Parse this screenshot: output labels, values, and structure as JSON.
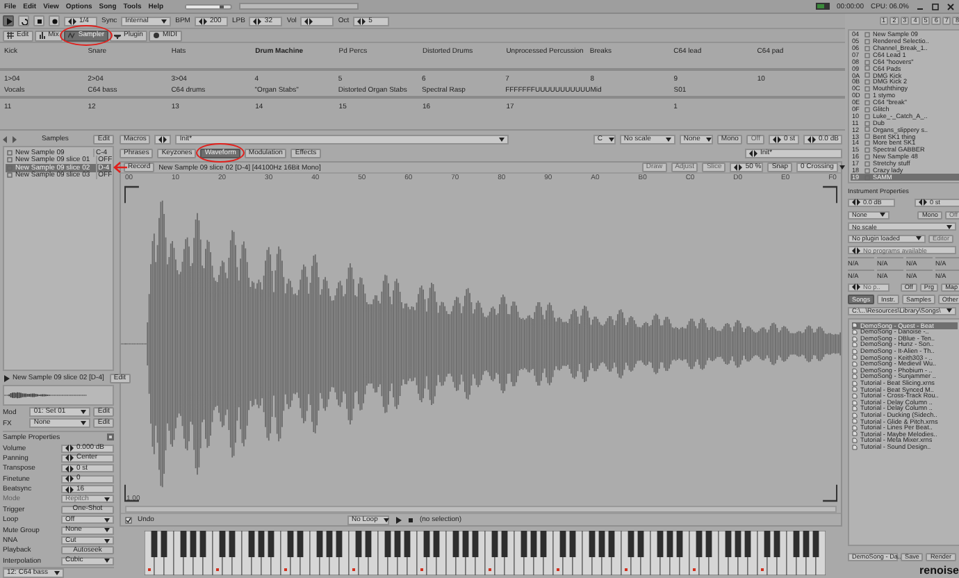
{
  "menu": [
    "File",
    "Edit",
    "View",
    "Options",
    "Song",
    "Tools",
    "Help"
  ],
  "master_volume": {
    "level": 0.85
  },
  "status": {
    "time": "00:00:00",
    "cpu": "CPU: 06.0%"
  },
  "toolbar": {
    "edit_step": "1/4",
    "sync_label": "Sync",
    "sync": "Internal",
    "bpm_label": "BPM",
    "bpm": "200",
    "lpb_label": "LPB",
    "lpb": "32",
    "vol_label": "Vol",
    "oct_label": "Oct",
    "oct": "5"
  },
  "tabs": [
    {
      "label": "Edit",
      "selected": false,
      "circled": false
    },
    {
      "label": "Mix",
      "selected": false,
      "circled": false
    },
    {
      "label": "Sampler",
      "selected": true,
      "circled": true
    },
    {
      "label": "Plugin",
      "selected": false,
      "circled": false
    },
    {
      "label": "MIDI",
      "selected": false,
      "circled": false
    }
  ],
  "pattern_columns": [
    [
      {
        "name": "Kick",
        "selected": false
      },
      {
        "number": "1>04",
        "name": "Vocals",
        "selected": false
      },
      {
        "number": "11",
        "selected": false
      }
    ],
    [
      {
        "name": "Snare",
        "selected": false
      },
      {
        "number": "2>04",
        "name": "C64 bass",
        "selected": false
      },
      {
        "number": "12",
        "selected": false
      }
    ],
    [
      {
        "name": "Hats",
        "selected": false
      },
      {
        "number": "3>04",
        "name": "C64 drums",
        "selected": false
      },
      {
        "number": "13",
        "selected": false
      }
    ],
    [
      {
        "name": "Drum Machine",
        "selected": true
      },
      {
        "number": "4",
        "name": "\"Organ Stabs\"",
        "selected": false
      },
      {
        "number": "14",
        "selected": false
      }
    ],
    [
      {
        "name": "Pd Percs",
        "selected": false
      },
      {
        "number": "5",
        "name": "Distorted Organ Stabs",
        "selected": false
      },
      {
        "number": "15",
        "selected": false
      }
    ],
    [
      {
        "name": "Distorted Drums",
        "selected": false
      },
      {
        "number": "6",
        "name": "Spectral Rasp",
        "selected": false
      },
      {
        "number": "16",
        "selected": false
      }
    ],
    [
      {
        "name": "Unprocessed Percussion",
        "selected": false
      },
      {
        "number": "7",
        "name": "FFFFFFFUUUUUUUUUUU",
        "selected": false
      },
      {
        "number": "17",
        "selected": false
      }
    ],
    [
      {
        "name": "Breaks",
        "selected": false
      },
      {
        "number": "8",
        "name": "Mid",
        "selected": false
      }
    ],
    [
      {
        "name": "C64 lead",
        "selected": false
      },
      {
        "number": "9",
        "name": "S01",
        "selected": false
      },
      {
        "number": "1",
        "selected": false
      }
    ],
    [
      {
        "name": "C64 pad",
        "selected": false
      },
      {
        "number": "10",
        "selected": false
      }
    ]
  ],
  "samples": {
    "title": "Samples",
    "edit": "Edit",
    "items": [
      {
        "name": "New Sample 09",
        "note": "C-4",
        "selected": false,
        "arrow": false
      },
      {
        "name": "New Sample 09 slice 01",
        "note": "OFF",
        "selected": false,
        "arrow": false
      },
      {
        "name": "New Sample 09 slice 02",
        "note": "D-4",
        "selected": true,
        "arrow": true
      },
      {
        "name": "New Sample 09 slice 03",
        "note": "OFF",
        "selected": false,
        "arrow": false
      }
    ]
  },
  "current_sample": {
    "name": "New Sample 09 slice 02 [D-4]",
    "edit": "Edit"
  },
  "mod": {
    "label": "Mod",
    "value": "01: Set 01",
    "edit": "Edit"
  },
  "fx": {
    "label": "FX",
    "value": "None",
    "edit": "Edit"
  },
  "sample_properties": {
    "title": "Sample Properties",
    "rows": [
      {
        "label": "Volume",
        "value": "0.000 dB",
        "kind": "spin",
        "disabled": false
      },
      {
        "label": "Panning",
        "value": "Center",
        "kind": "spin",
        "disabled": false
      },
      {
        "label": "Transpose",
        "value": "0 st",
        "kind": "spin",
        "disabled": false
      },
      {
        "label": "Finetune",
        "value": "0",
        "kind": "spin",
        "disabled": false
      },
      {
        "label": "Beatsync",
        "value": "16",
        "kind": "spin",
        "disabled": false
      },
      {
        "label": "Mode",
        "value": "Repitch",
        "kind": "dropdown",
        "disabled": true
      },
      {
        "label": "Trigger",
        "value": "One-Shot",
        "kind": "button",
        "disabled": false
      },
      {
        "label": "Loop",
        "value": "Off",
        "kind": "dropdown",
        "disabled": false
      },
      {
        "label": "Mute Group",
        "value": "None",
        "kind": "dropdown",
        "disabled": false
      },
      {
        "label": "NNA",
        "value": "Cut",
        "kind": "dropdown",
        "disabled": false
      },
      {
        "label": "Playback",
        "value": "Autoseek",
        "kind": "button",
        "disabled": false
      },
      {
        "label": "Interpolation",
        "value": "Cubic",
        "kind": "dropdown",
        "disabled": false
      }
    ]
  },
  "status_line": "12: C64 bass",
  "instrument_bar": {
    "macros": "Macros",
    "preset": "Init*",
    "key": "C",
    "scale": "No scale",
    "keyzone": "None",
    "mono": "Mono",
    "glide": "Off",
    "transpose": "0 st",
    "volume": "0.0 dB"
  },
  "editor_tabs": [
    {
      "label": "Phrases",
      "selected": false,
      "circled": false
    },
    {
      "label": "Keyzones",
      "selected": false,
      "circled": false
    },
    {
      "label": "Waveform",
      "selected": true,
      "circled": true
    },
    {
      "label": "Modulation",
      "selected": false,
      "circled": false
    },
    {
      "label": "Effects",
      "selected": false,
      "circled": false
    }
  ],
  "fx_preset": "Init*",
  "waveform_header": {
    "record": "Record",
    "title": "New Sample 09 slice 02 [D-4] [44100Hz 16Bit Mono]",
    "draw": "Draw",
    "adjust": "Adjust",
    "slice": "Slice",
    "zoom": "50 %",
    "snap": "Snap",
    "crossing": "0 Crossing"
  },
  "ruler": [
    "00",
    "10",
    "20",
    "30",
    "40",
    "50",
    "60",
    "70",
    "80",
    "90",
    "A0",
    "B0",
    "C0",
    "D0",
    "E0",
    "F0"
  ],
  "waveform_scale": "1.00",
  "waveform_footer": {
    "undo": "Undo",
    "loop": "No Loop",
    "selection": "(no selection)"
  },
  "track_buttons": [
    "1",
    "2",
    "3",
    "4",
    "5",
    "6",
    "7",
    "8"
  ],
  "instruments": [
    {
      "index": "04",
      "name": "New Sample 09",
      "selected": false
    },
    {
      "index": "05",
      "name": "Rendered Selectio..",
      "selected": false
    },
    {
      "index": "06",
      "name": "Channel_Break_1..",
      "selected": false
    },
    {
      "index": "07",
      "name": "C64 Lead 1",
      "selected": false
    },
    {
      "index": "08",
      "name": "C64 \"hoovers\"",
      "selected": false
    },
    {
      "index": "09",
      "name": "C64 Pads",
      "selected": false
    },
    {
      "index": "0A",
      "name": "DMG Kick",
      "selected": false
    },
    {
      "index": "0B",
      "name": "DMG Kick 2",
      "selected": false
    },
    {
      "index": "0C",
      "name": "Mouththingy",
      "selected": false
    },
    {
      "index": "0D",
      "name": "1 stymo",
      "selected": false
    },
    {
      "index": "0E",
      "name": "C64 \"break\"",
      "selected": false
    },
    {
      "index": "0F",
      "name": "Glitch",
      "selected": false
    },
    {
      "index": "10",
      "name": "Luke_-_Catch_A_..",
      "selected": false
    },
    {
      "index": "11",
      "name": "Dub",
      "selected": false
    },
    {
      "index": "12",
      "name": "Organs_slippery s..",
      "selected": false
    },
    {
      "index": "13",
      "name": "Bent SK1 thing",
      "selected": false
    },
    {
      "index": "14",
      "name": "More bent SK1",
      "selected": false
    },
    {
      "index": "15",
      "name": "Spectral GABBER",
      "selected": false
    },
    {
      "index": "16",
      "name": "New Sample 48",
      "selected": false
    },
    {
      "index": "17",
      "name": "Stretchy stuff",
      "selected": false
    },
    {
      "index": "18",
      "name": "Crazy lady",
      "selected": false
    },
    {
      "index": "19",
      "name": "SAMM",
      "selected": true
    }
  ],
  "instrument_properties": {
    "title": "Instrument Properties",
    "volume": "0.0 dB",
    "transpose": "0 st",
    "keyzone": "None",
    "mono": "Mono",
    "glide": "Off",
    "scale": "No scale",
    "plugin": "No plugin loaded",
    "editor": "Editor",
    "programs": "No programs available",
    "macros": [
      "N/A",
      "N/A",
      "N/A",
      "N/A",
      "N/A",
      "N/A",
      "N/A",
      "N/A"
    ],
    "program": "No p..",
    "buttons": [
      "Off",
      "Prg",
      "Map"
    ]
  },
  "browser": {
    "tabs": [
      {
        "label": "Songs",
        "selected": true
      },
      {
        "label": "Instr.",
        "selected": false
      },
      {
        "label": "Samples",
        "selected": false
      },
      {
        "label": "Other",
        "selected": false
      }
    ],
    "path": "C:\\...\\Resources\\Library\\Songs\\",
    "files": [
      {
        "name": "DemoSong - Quest - Beat",
        "selected": true
      },
      {
        "name": "DemoSong - Danoise -..",
        "selected": false
      },
      {
        "name": "DemoSong - DBlue - Ten..",
        "selected": false
      },
      {
        "name": "DemoSong - Hunz - Son..",
        "selected": false
      },
      {
        "name": "DemoSong - It-Alien - Th..",
        "selected": false
      },
      {
        "name": "DemoSong - Keith303 - ..",
        "selected": false
      },
      {
        "name": "DemoSong - Medievil Wu..",
        "selected": false
      },
      {
        "name": "DemoSong - Phobium - ..",
        "selected": false
      },
      {
        "name": "DemoSong - Sunjammer ..",
        "selected": false
      },
      {
        "name": "Tutorial - Beat Slicing.xrns",
        "selected": false
      },
      {
        "name": "Tutorial - Beat Synced M..",
        "selected": false
      },
      {
        "name": "Tutorial - Cross-Track Rou..",
        "selected": false
      },
      {
        "name": "Tutorial - Delay Column ..",
        "selected": false
      },
      {
        "name": "Tutorial - Delay Column ..",
        "selected": false
      },
      {
        "name": "Tutorial - Ducking (Sidech..",
        "selected": false
      },
      {
        "name": "Tutorial - Glide & Pitch.xrns",
        "selected": false
      },
      {
        "name": "Tutorial - Lines Per Beat..",
        "selected": false
      },
      {
        "name": "Tutorial - Maybe Melodies..",
        "selected": false
      },
      {
        "name": "Tutorial - Meta Mixer.xrns",
        "selected": false
      },
      {
        "name": "Tutorial - Sound Design..",
        "selected": false
      }
    ],
    "current": "DemoSong - Da..",
    "save": "Save",
    "render": "Render"
  },
  "logo": "renoise"
}
